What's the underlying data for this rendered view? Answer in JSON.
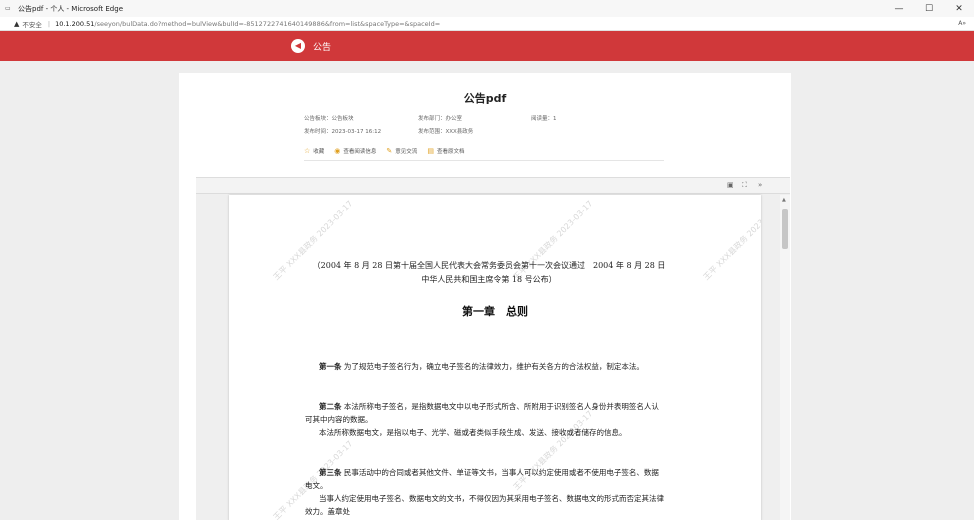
{
  "window": {
    "title": "公告pdf - 个人 - Microsoft Edge",
    "controls": [
      "—",
      "☐",
      "✕"
    ]
  },
  "address": {
    "security_label": "不安全",
    "url_host": "10.1.200.51",
    "url_rest": "/seeyon/bulData.do?method=bulView&bulId=-8512722741640149886&from=list&spaceType=&spaceId="
  },
  "header": {
    "title": "公告"
  },
  "article": {
    "title": "公告pdf",
    "meta": {
      "board": "公告板块：公告板块",
      "dept": "发布部门：办公室",
      "reads": "阅读量：1",
      "time": "发布时间：2023-03-17 16:12",
      "scope": "发布范围：XXX县政务"
    },
    "actions": {
      "favorite": "收藏",
      "view_reads": "查看阅读信息",
      "feedback": "意见交流",
      "view_original": "查看原文档"
    }
  },
  "pdf": {
    "watermark": "王平 XXX县政务 2023-03-17",
    "note": "（2004 年 8 月 28 日第十届全国人民代表大会常务委员会第十一次会议通过　2004 年 8 月 28 日 中华人民共和国主席令第 18 号公布）",
    "chapter": "第一章　总则",
    "p1_head": "第一条",
    "p1_text": " 为了规范电子签名行为，确立电子签名的法律效力，维护有关各方的合法权益，制定本法。",
    "p2_head": "第二条",
    "p2_text": " 本法所称电子签名，是指数据电文中以电子形式所含、所附用于识别签名人身份并表明签名人认可其中内容的数据。",
    "p2b_text": "本法所称数据电文，是指以电子、光学、磁或者类似手段生成、发送、接收或者储存的信息。",
    "p3_head": "第三条",
    "p3_text": " 民事活动中的合同或者其他文件、单证等文书，当事人可以约定使用或者不使用电子签名、数据电文。",
    "p3b_text": "当事人约定使用电子签名、数据电文的文书，不得仅因为其采用电子签名、数据电文的形式而否定其法律效力。盖章处"
  }
}
